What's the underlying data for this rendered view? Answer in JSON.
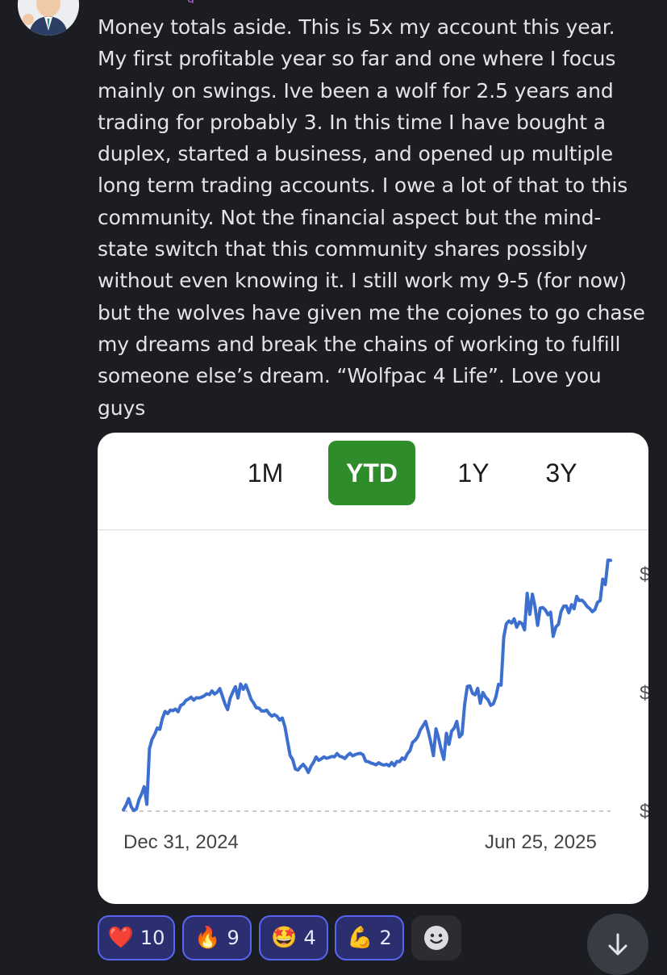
{
  "message": {
    "author_fragment": "g",
    "text": "Money totals aside. This is 5x my account this year.\nMy first profitable year so far and one where I focus\nmainly on swings. Ive been a wolf for 2.5 years and\ntrading for probably 3. In this time I have bought a\nduplex, started a business, and opened up multiple\nlong term trading accounts. I owe a lot of that to this\ncommunity. Not the financial aspect but the mind-\nstate switch that this community shares possibly\nwithout even knowing it. I still work my 9-5 (for now)\nbut the wolves have given me the cojones to go chase\nmy dreams and break the chains of working to fulfill\nsomeone else’s dream. “Wolfpac 4 Life”. Love you\nguys"
  },
  "chart_card": {
    "tabs": [
      {
        "label": "1M",
        "active": false
      },
      {
        "label": "YTD",
        "active": true
      },
      {
        "label": "1Y",
        "active": false
      },
      {
        "label": "3Y",
        "active": false
      }
    ],
    "start_date": "Dec 31, 2024",
    "end_date": "Jun 25, 2025",
    "active_color": "#2f8c2a",
    "line_color": "#3d6fcf"
  },
  "chart_data": {
    "type": "line",
    "series": [
      {
        "values": [
          0.5,
          2.2,
          4.8,
          1.7,
          0.2,
          0.8,
          4.4,
          6.6,
          9.3,
          2.6,
          23.7,
          27.3,
          29.2,
          31.6,
          31.1,
          35.3,
          37.9,
          37.1,
          38.4,
          38.2,
          38.8,
          37.8,
          40.2,
          40.7,
          42.1,
          42.6,
          43.3,
          42.2,
          43.1,
          43.0,
          43.3,
          43.8,
          44.6,
          44.3,
          45.7,
          44.5,
          45.2,
          46.6,
          43.8,
          40.7,
          38.6,
          42.9,
          45.3,
          47.3,
          43.0,
          48.3,
          46.3,
          48.0,
          45.5,
          42.5,
          41.1,
          39.3,
          39.2,
          38.1,
          38.0,
          38.4,
          37.0,
          36.1,
          36.7,
          36.0,
          34.6,
          35.4,
          32.1,
          26.6,
          21.2,
          19.6,
          16.0,
          15.6,
          16.8,
          17.8,
          16.6,
          14.7,
          17.1,
          18.6,
          20.6,
          19.3,
          19.9,
          20.6,
          20.1,
          20.4,
          20.8,
          20.6,
          21.9,
          20.9,
          20.6,
          20.0,
          21.2,
          22.0,
          21.0,
          21.5,
          21.8,
          22.0,
          21.4,
          19.0,
          18.8,
          18.3,
          18.0,
          17.6,
          18.4,
          17.8,
          17.5,
          17.8,
          17.2,
          18.5,
          17.3,
          18.9,
          18.8,
          20.2,
          19.7,
          21.8,
          23.0,
          26.1,
          27.0,
          28.3,
          30.9,
          32.4,
          34.1,
          30.4,
          26.2,
          21.1,
          31.3,
          27.7,
          23.2,
          19.7,
          29.6,
          25.4,
          30.4,
          31.6,
          34.1,
          28.2,
          29.3,
          40.5,
          47.4,
          47.6,
          44.8,
          44.2,
          46.7,
          41.0,
          45.1,
          43.3,
          42.3,
          40.2,
          40.8,
          43.5,
          48.2,
          47.9,
          66.2,
          71.2,
          72.3,
          71.5,
          73.1,
          69.9,
          71.9,
          71.3,
          68.9,
          82.8,
          74.8,
          82.5,
          77.8,
          70.6,
          77.2,
          77.4,
          76.4,
          74.6,
          75.6,
          66.4,
          70.0,
          71.0,
          75.8,
          77.9,
          78.0,
          75.4,
          78.5,
          76.9,
          81.6,
          80.0,
          80.2,
          79.2,
          77.8,
          77.0,
          75.8,
          76.6,
          79.4,
          80.0,
          88.2,
          86.1,
          95.4,
          95.3
        ]
      }
    ],
    "ylim": [
      0,
      100
    ],
    "y_tick_labels": [
      "$",
      "$",
      "$"
    ],
    "baseline": 0,
    "x_tick_labels": [
      "Dec 31, 2024",
      "Jun 25, 2025"
    ],
    "grid": false
  },
  "reactions": [
    {
      "emoji": "❤️",
      "count": "10"
    },
    {
      "emoji": "🔥",
      "count": "9"
    },
    {
      "emoji": "🤩",
      "count": "4"
    },
    {
      "emoji": "💪",
      "count": "2"
    }
  ],
  "icons": {
    "add_reaction": "smiley-face-icon",
    "scroll_down": "arrow-down-icon"
  }
}
